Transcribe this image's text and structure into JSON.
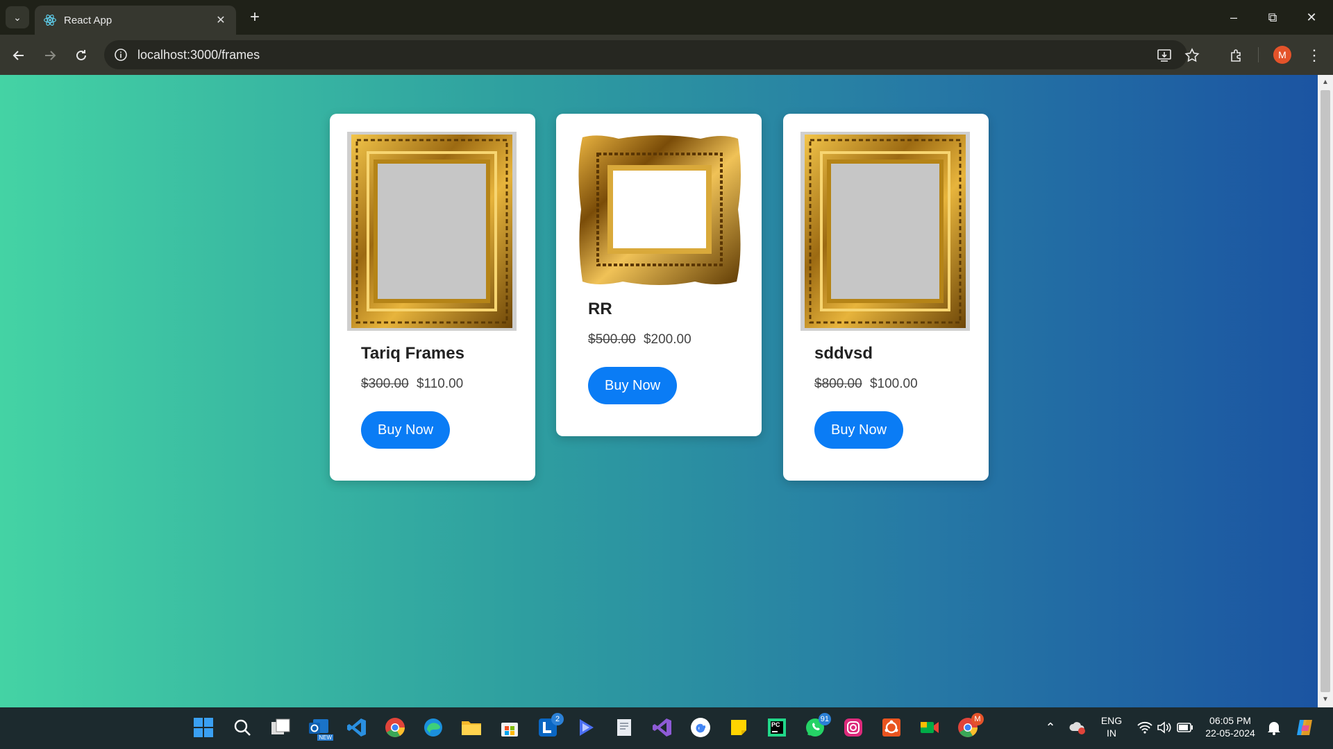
{
  "browser": {
    "tab_title": "React App",
    "url": "localhost:3000/frames",
    "profile_initial": "M"
  },
  "products": [
    {
      "name": "Tariq Frames",
      "old_price": "$300.00",
      "price": "$110.00",
      "button": "Buy Now",
      "image": "ornate-gold-frame-grey-canvas"
    },
    {
      "name": "RR",
      "old_price": "$500.00",
      "price": "$200.00",
      "button": "Buy Now",
      "image": "ornate-gold-frame-white"
    },
    {
      "name": "sddvsd",
      "old_price": "$800.00",
      "price": "$100.00",
      "button": "Buy Now",
      "image": "ornate-gold-frame-grey-canvas"
    }
  ],
  "taskbar": {
    "lang": "ENG",
    "region": "IN",
    "time": "06:05 PM",
    "date": "22-05-2024",
    "badges": {
      "linkedin": "2",
      "whatsapp": "91",
      "chrome": "M"
    },
    "outlook_tag": "NEW",
    "pycharm_tag": "PC"
  },
  "colors": {
    "gradient_start": "#44d3a4",
    "gradient_end": "#1b54a2",
    "button": "#0a7cf5"
  }
}
